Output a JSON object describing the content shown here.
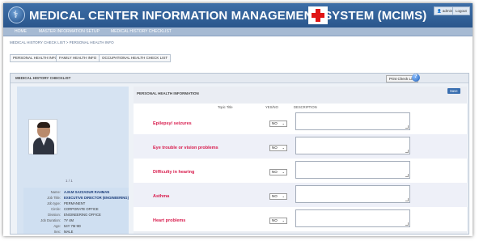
{
  "header": {
    "title": "MEDICAL CENTER INFORMATION MANAGEMENT SYSTEM (MCIMS)",
    "user_label": "admin",
    "logout_label": "Logout"
  },
  "nav": {
    "items": [
      "HOME",
      "MASTER INFORMATION SETUP",
      "MEDICAL HISTORY CHECKLIST"
    ]
  },
  "breadcrumb": "MEDICAL HISTORY CHECK LIST > PERSONAL HEALTH INFO",
  "tabs": [
    "PERSONAL HEALTH INFO",
    "FAMILY HEALTH INFO",
    "OCCUPATIONAL HEALTH CHECK LIST"
  ],
  "panel": {
    "title": "MEDICAL HISTORY CHECKLIST",
    "print_label": "Print Check List"
  },
  "profile": {
    "pager": "1 / 1",
    "fields": [
      {
        "label": "Name:",
        "value": "A.M.M SAZZADUR RAHMAN",
        "strong": true
      },
      {
        "label": "Job Title:",
        "value": "EXECUTIVE DIRECTOR (ENGINEERING)",
        "strong": true
      },
      {
        "label": "Job type:",
        "value": "PERMANENT",
        "strong": false
      },
      {
        "label": "Circle:",
        "value": "CORPORATE OFFICE",
        "strong": false
      },
      {
        "label": "Division:",
        "value": "ENGINEERING OFFICE",
        "strong": false
      },
      {
        "label": "Job Duration:",
        "value": "7Y 4M",
        "strong": false
      },
      {
        "label": "Age:",
        "value": "54Y 7M 9D",
        "strong": false
      },
      {
        "label": "Sex:",
        "value": "MALE",
        "strong": false
      }
    ]
  },
  "health": {
    "section_title": "PERSONAL HEALTH INFORMATION",
    "save_label": "Save",
    "columns": {
      "topic": "Topic Title",
      "yesno": "YES/NO",
      "description": "DESCRIPTION"
    },
    "rows": [
      {
        "topic": "Epilepsy/ seizures",
        "answer": "NO"
      },
      {
        "topic": "Eye trouble or vision problems",
        "answer": "NO"
      },
      {
        "topic": "Difficulty in hearing",
        "answer": "NO"
      },
      {
        "topic": "Asthma",
        "answer": "NO"
      },
      {
        "topic": "Heart problems",
        "answer": "NO"
      }
    ]
  },
  "colors": {
    "header_bg": "#2f5d96",
    "nav_bg": "#a6bad3",
    "topic_text": "#d81b4c",
    "logo_cross": "#e01515"
  }
}
